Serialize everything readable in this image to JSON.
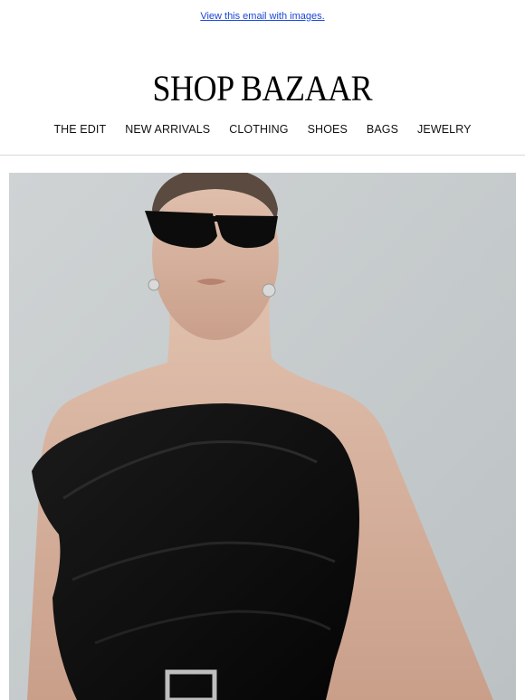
{
  "header": {
    "view_link": "View this email with images.",
    "logo": "SHOP BAZAAR"
  },
  "nav": {
    "items": [
      {
        "label": "THE EDIT"
      },
      {
        "label": "NEW ARRIVALS"
      },
      {
        "label": "CLOTHING"
      },
      {
        "label": "SHOES"
      },
      {
        "label": "BAGS"
      },
      {
        "label": "JEWELRY"
      }
    ]
  },
  "colors": {
    "link": "#1a45d6",
    "backdrop": "#c9ced0",
    "garment": "#0f0f0f",
    "skin": "#d9b7a3"
  }
}
